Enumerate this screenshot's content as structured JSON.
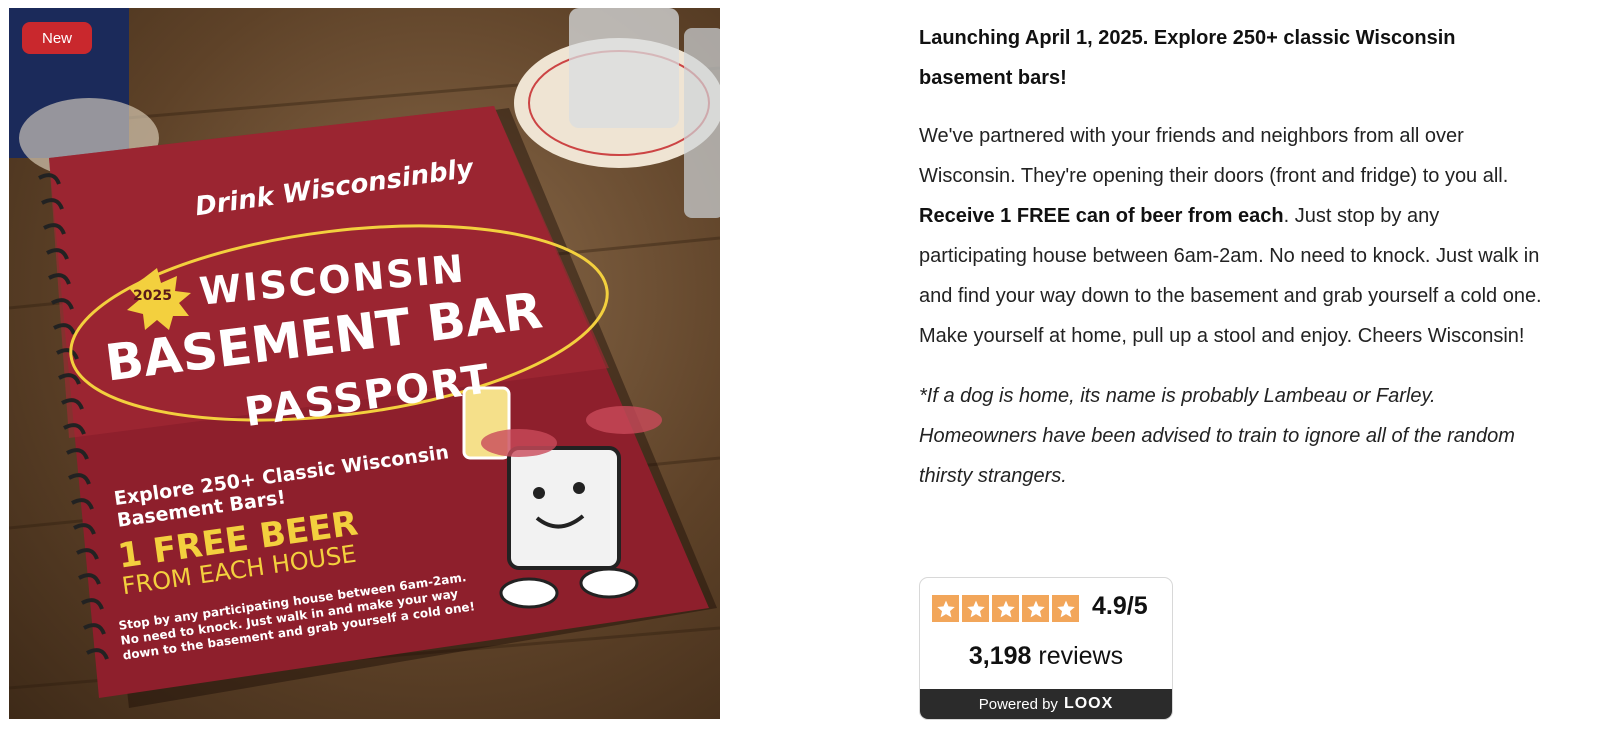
{
  "product": {
    "badge": "New",
    "cover": {
      "script_title": "Drink Wisconsinbly",
      "year": "2025",
      "line1": "WISCONSIN",
      "line2": "BASEMENT BAR",
      "line3": "PASSPORT",
      "explore": "Explore 250+ Classic Wisconsin Basement Bars!",
      "free_beer": "1 FREE BEER",
      "each_house": "FROM EACH HOUSE",
      "fine_print": "Stop by any participating house between 6am-2am. No need to knock. Just walk in and make your way down to the basement and grab yourself a cold one!"
    }
  },
  "description": {
    "title": "Launching April 1, 2025. Explore 250+ classic Wisconsin basement bars!",
    "body_before": "We've partnered with your friends and neighbors from all over Wisconsin. They're opening their doors (front and fridge) to you all. ",
    "body_bold": "Receive 1 FREE can of beer from each",
    "body_after": ". Just stop by any participating house between 6am-2am. No need to knock. Just walk in and find your way down to the basement and grab yourself a cold one. Make yourself at home, pull up a stool and enjoy. Cheers Wisconsin!",
    "note": "*If a dog is home, its name is probably Lambeau or Farley. Homeowners have been advised to train to ignore all of the random thirsty strangers."
  },
  "rating": {
    "stars": 5,
    "score": "4.9/5",
    "count": "3,198",
    "reviews_label": "reviews",
    "powered_by": "Powered by",
    "brand": "LOOX",
    "star_color": "#f2a65a"
  },
  "colors": {
    "badge": "#c9282d",
    "cover_red": "#8e1f2c",
    "cover_yellow": "#f3d03e"
  }
}
